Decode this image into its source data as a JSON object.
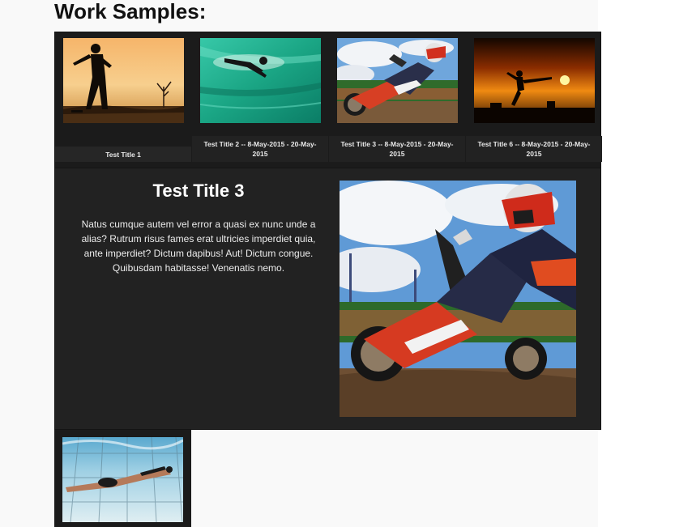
{
  "page": {
    "heading": "Work Samples:"
  },
  "gallery": {
    "items": [
      {
        "caption": "Test Title 1",
        "image": "silhouette-player-sunset-photo"
      },
      {
        "caption": "Test Title 2 -- 8-May-2015 - 20-May-2015",
        "image": "surfer-wave-photo"
      },
      {
        "caption": "Test Title 3 -- 8-May-2015 - 20-May-2015",
        "image": "motocross-rider-photo"
      },
      {
        "caption": "Test Title 6 -- 8-May-2015 - 20-May-2015",
        "image": "kick-sunset-silhouette-photo"
      }
    ]
  },
  "detail": {
    "title": "Test Title 3",
    "description": "Natus cumque autem vel error a quasi ex nunc unde a alias? Rutrum risus fames erat ultricies imperdiet quia, ante imperdiet? Dictum dapibus! Aut! Dictum congue. Quibusdam habitasse! Venenatis nemo.",
    "image": "motocross-rider-photo"
  },
  "gallery_row2": {
    "items": [
      {
        "image": "swimmer-underwater-photo"
      }
    ]
  },
  "colors": {
    "gallery_bg": "#1b1b1b",
    "detail_bg": "#222222",
    "page_bg": "#f9f9f9"
  }
}
